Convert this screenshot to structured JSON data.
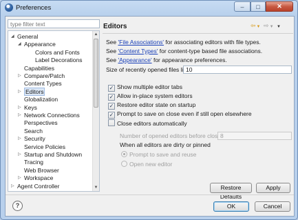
{
  "window": {
    "title": "Preferences"
  },
  "filter": {
    "placeholder": "type filter text"
  },
  "tree": {
    "items": [
      {
        "label": "General",
        "twisty": "open"
      },
      {
        "label": "Appearance",
        "twisty": "open"
      },
      {
        "label": "Colors and Fonts",
        "twisty": ""
      },
      {
        "label": "Label Decorations",
        "twisty": ""
      },
      {
        "label": "Capabilities",
        "twisty": ""
      },
      {
        "label": "Compare/Patch",
        "twisty": "closed"
      },
      {
        "label": "Content Types",
        "twisty": ""
      },
      {
        "label": "Editors",
        "twisty": "closed",
        "selected": true
      },
      {
        "label": "Globalization",
        "twisty": ""
      },
      {
        "label": "Keys",
        "twisty": "closed"
      },
      {
        "label": "Network Connections",
        "twisty": "closed"
      },
      {
        "label": "Perspectives",
        "twisty": ""
      },
      {
        "label": "Search",
        "twisty": ""
      },
      {
        "label": "Security",
        "twisty": "closed"
      },
      {
        "label": "Service Policies",
        "twisty": ""
      },
      {
        "label": "Startup and Shutdown",
        "twisty": "closed"
      },
      {
        "label": "Tracing",
        "twisty": ""
      },
      {
        "label": "Web Browser",
        "twisty": ""
      },
      {
        "label": "Workspace",
        "twisty": "closed"
      },
      {
        "label": "Agent Controller",
        "twisty": "closed"
      }
    ]
  },
  "editors": {
    "title": "Editors",
    "line1": {
      "pre": "See ",
      "link": "'File Associations'",
      "post": " for associating editors with file types."
    },
    "line2": {
      "pre": "See ",
      "link": "'Content Types'",
      "post": " for content-type based file associations."
    },
    "line3": {
      "pre": "See ",
      "link": "'Appearance'",
      "post": " for appearance preferences."
    },
    "recent_label": "Size of recently opened files list:",
    "recent_value": "10",
    "checkboxes": [
      {
        "label": "Show multiple editor tabs",
        "checked": true
      },
      {
        "label": "Allow in-place system editors",
        "checked": true
      },
      {
        "label": "Restore editor state on startup",
        "checked": true
      },
      {
        "label": "Prompt to save on close even if still open elsewhere",
        "checked": true
      },
      {
        "label": "Close editors automatically",
        "checked": false
      }
    ],
    "open_label": "Number of opened editors before closing:",
    "open_value": "8",
    "dirty_label": "When all editors are dirty or pinned",
    "radios": [
      {
        "label": "Prompt to save and reuse",
        "selected": true
      },
      {
        "label": "Open new editor",
        "selected": false
      }
    ],
    "restore_defaults": "Restore Defaults",
    "apply": "Apply"
  },
  "footer": {
    "ok": "OK",
    "cancel": "Cancel",
    "help_glyph": "?"
  },
  "icons": {
    "minimize": "–",
    "maximize": "□",
    "close": "✕",
    "check": "✓"
  }
}
